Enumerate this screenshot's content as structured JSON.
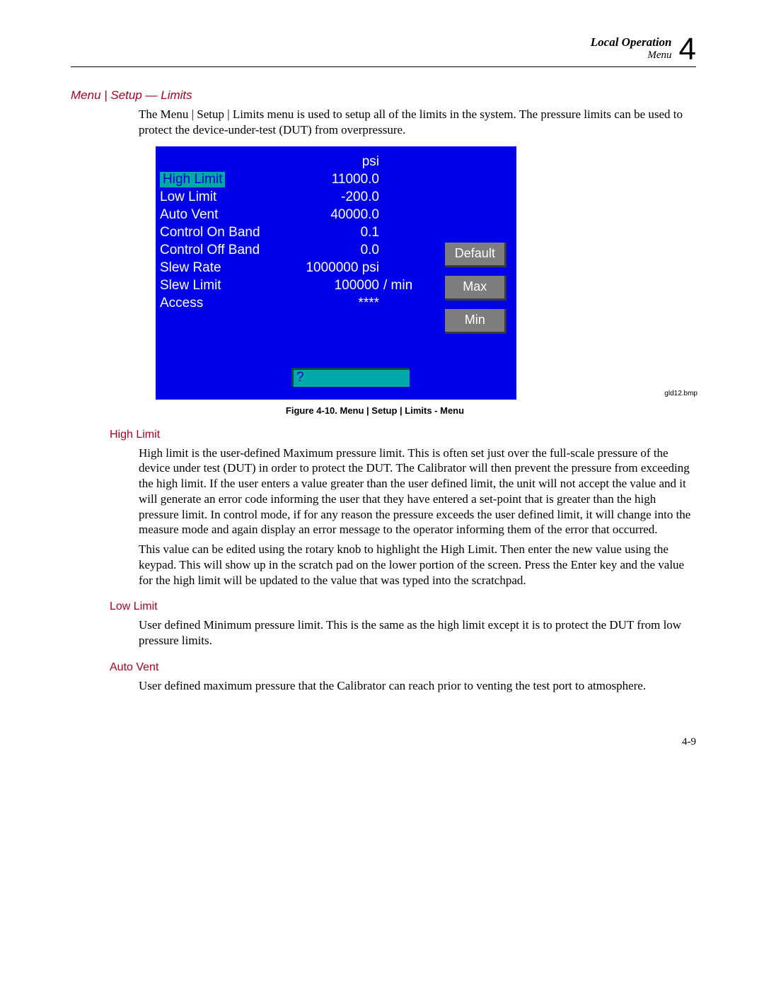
{
  "header": {
    "section": "Local Operation",
    "subsection": "Menu",
    "chapter": "4"
  },
  "title": "Menu | Setup — Limits",
  "intro": "The Menu | Setup | Limits menu is used to setup all of the limits in the system. The pressure limits can be used to protect the device-under-test (DUT) from overpressure.",
  "screen": {
    "unit_header": "psi",
    "rows": {
      "r0": {
        "label": "High Limit",
        "value": "11000.0"
      },
      "r1": {
        "label": "Low Limit",
        "value": "-200.0"
      },
      "r2": {
        "label": "Auto Vent",
        "value": "40000.0"
      },
      "r3": {
        "label": "Control On Band",
        "value": "0.1"
      },
      "r4": {
        "label": "Control Off Band",
        "value": "0.0"
      },
      "r5": {
        "label": "Slew Rate",
        "value": "1000000 psi"
      },
      "r6": {
        "label": "Slew Limit",
        "value": "100000",
        "unit": "/ min"
      },
      "r7": {
        "label": "Access",
        "value": "****"
      }
    },
    "scratchpad": "?",
    "softkeys": {
      "k0": "Default",
      "k1": "Max",
      "k2": "Min"
    }
  },
  "figure": {
    "caption": "Figure 4-10. Menu | Setup | Limits - Menu",
    "bmp": "gld12.bmp"
  },
  "sections": {
    "high_limit": {
      "heading": "High Limit",
      "p1": "High limit is the user-defined Maximum pressure limit. This is often set just over the full-scale pressure of the device under test (DUT) in order to protect the DUT. The Calibrator will then prevent the pressure from exceeding the high limit. If the user enters a value greater than the user defined limit, the unit will not accept the value and it will generate an error code informing the user that they have entered a set-point that is greater than the high pressure limit. In control mode, if for any reason the pressure exceeds the user defined limit, it will change into the measure mode and again display an error message to the operator informing them of the error that occurred.",
      "p2": "This value can be edited using the rotary knob to highlight the High Limit. Then enter the new value using the keypad. This will show up in the scratch pad on the lower portion of the screen. Press the Enter key and the value for the high limit will be updated to the value that was typed into the scratchpad."
    },
    "low_limit": {
      "heading": "Low Limit",
      "p1": "User defined Minimum pressure limit. This is the same as the high limit except it is to protect the DUT from low pressure limits."
    },
    "auto_vent": {
      "heading": "Auto Vent",
      "p1": "User defined maximum pressure that the Calibrator can reach prior to venting the test port to atmosphere."
    }
  },
  "pagenum": "4-9"
}
